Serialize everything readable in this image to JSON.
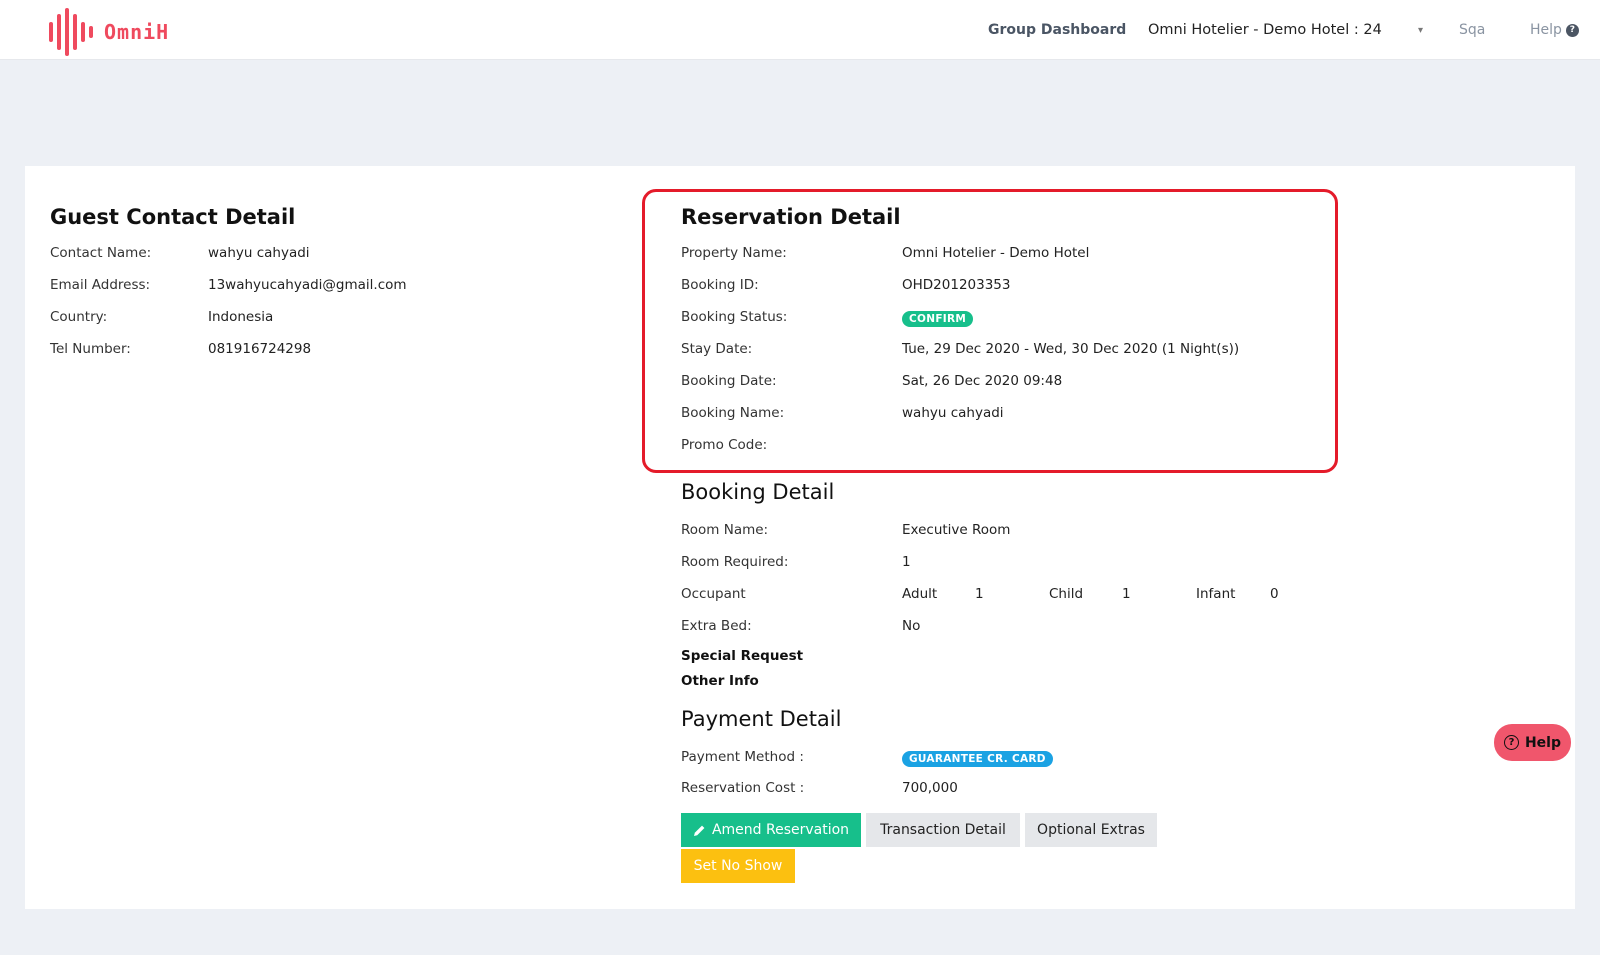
{
  "header": {
    "logo_text": "OmniH",
    "group_dashboard": "Group Dashboard",
    "hotel_selector": "Omni Hotelier - Demo Hotel : 24",
    "caret": "▾",
    "user": "Sqa",
    "help": "Help",
    "help_icon": "?"
  },
  "guest": {
    "title": "Guest Contact Detail",
    "rows": [
      {
        "label": "Contact Name:",
        "value": "wahyu cahyadi"
      },
      {
        "label": "Email Address:",
        "value": "13wahyucahyadi@gmail.com"
      },
      {
        "label": "Country:",
        "value": "Indonesia"
      },
      {
        "label": "Tel Number:",
        "value": "081916724298"
      }
    ]
  },
  "reservation": {
    "title": "Reservation Detail",
    "property_label": "Property Name:",
    "property_value": "Omni Hotelier - Demo Hotel",
    "booking_id_label": "Booking ID:",
    "booking_id_value": "OHD201203353",
    "status_label": "Booking Status:",
    "status_value": "CONFIRM",
    "stay_label": "Stay Date:",
    "stay_value": "Tue, 29 Dec 2020 - Wed, 30 Dec 2020 (1 Night(s))",
    "booking_date_label": "Booking Date:",
    "booking_date_value": "Sat, 26 Dec 2020 09:48",
    "booking_name_label": "Booking Name:",
    "booking_name_value": "wahyu cahyadi",
    "promo_label": "Promo Code:",
    "promo_value": ""
  },
  "booking": {
    "title": "Booking Detail",
    "room_name_label": "Room Name:",
    "room_name_value": "Executive Room",
    "room_required_label": "Room Required:",
    "room_required_value": "1",
    "occupant_label": "Occupant",
    "adult_label": "Adult",
    "adult_value": "1",
    "child_label": "Child",
    "child_value": "1",
    "infant_label": "Infant",
    "infant_value": "0",
    "extra_bed_label": "Extra Bed:",
    "extra_bed_value": "No",
    "special_request": "Special Request",
    "other_info": "Other Info"
  },
  "payment": {
    "title": "Payment Detail",
    "method_label": "Payment Method :",
    "method_value": "GUARANTEE CR. CARD",
    "cost_label": "Reservation Cost :",
    "cost_value": "700,000"
  },
  "actions": {
    "amend": "Amend Reservation",
    "transaction": "Transaction Detail",
    "extras": "Optional Extras",
    "no_show": "Set No Show"
  },
  "help_button": {
    "label": "Help",
    "icon": "?"
  },
  "colors": {
    "brand": "#ef4a5e",
    "confirm_badge": "#17bf8b",
    "payment_badge": "#1ba2e3",
    "amend_button": "#17bf8b",
    "no_show_button": "#fcc010",
    "highlight_border": "#e41b2a"
  }
}
